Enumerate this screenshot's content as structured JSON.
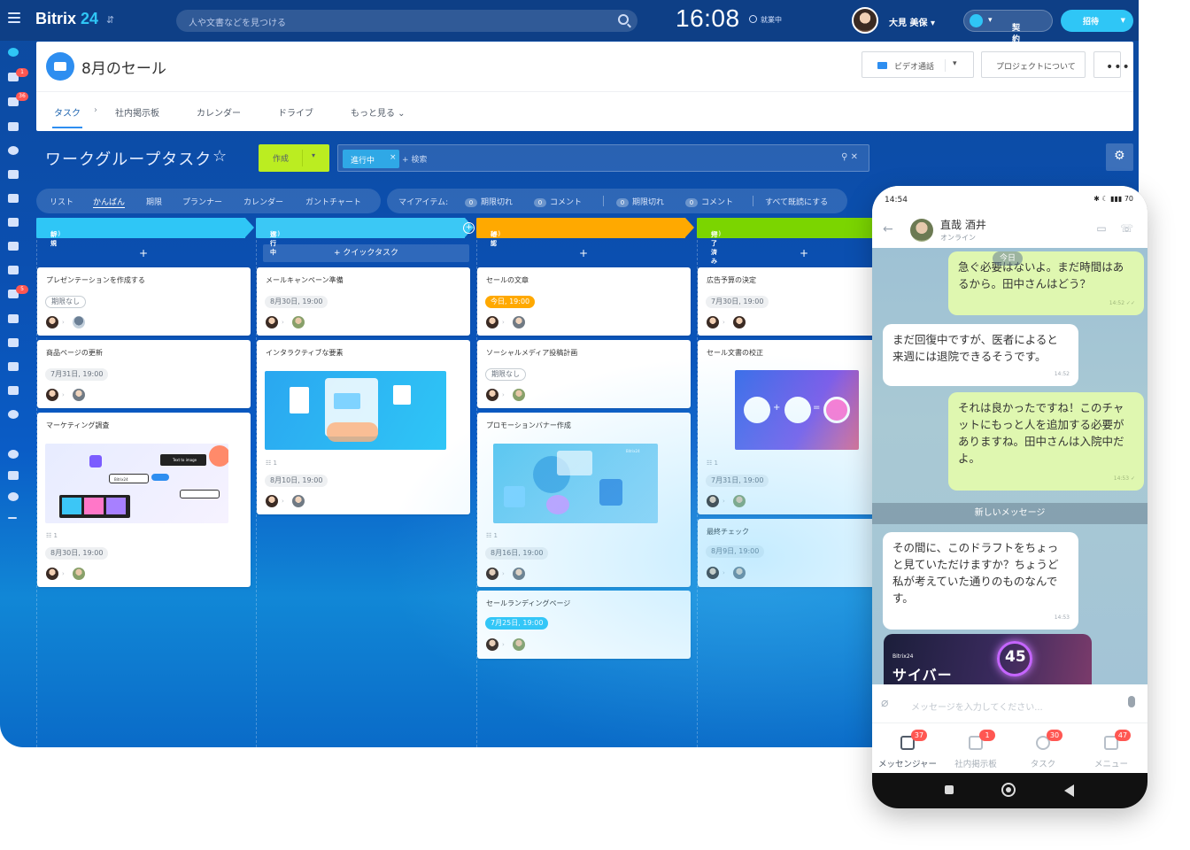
{
  "app": {
    "brand": "Bitrix",
    "brand_num": "24",
    "search_placeholder": "人や文書などを見つける",
    "clock": "16:08",
    "work_status": "就業中",
    "user_name": "大見 美保",
    "plan_label": "契約プラン",
    "invite_label": "招待"
  },
  "rail_badges": [
    "1",
    "36",
    "5"
  ],
  "project": {
    "title": "8月のセール",
    "video_call": "ビデオ通話",
    "about": "プロジェクトについて",
    "tabs": [
      "タスク",
      "社内掲示板",
      "カレンダー",
      "ドライブ",
      "もっと見る"
    ]
  },
  "workgroup": {
    "title": "ワークグループタスク",
    "create": "作成",
    "filter_chip": "進行中",
    "filter_search": "+ 検索"
  },
  "views": [
    "リスト",
    "かんばん",
    "期限",
    "プランナー",
    "カレンダー",
    "ガントチャート"
  ],
  "counters": {
    "my_items": "マイアイテム:",
    "c1": "0",
    "overdue": "期限切れ",
    "c2": "0",
    "comments": "コメント",
    "c3": "0",
    "overdue2": "期限切れ",
    "c4": "0",
    "comments2": "コメント",
    "mark_read": "すべて既読にする"
  },
  "columns": [
    {
      "name": "新規",
      "count": "(3)",
      "color": "#2fc6f6"
    },
    {
      "name": "進行中",
      "count": "(2)",
      "color": "#3bc8f5",
      "quick": "+ クイックタスク"
    },
    {
      "name": "確認",
      "count": "(4)",
      "color": "#ffa900"
    },
    {
      "name": "完了済み",
      "count": "(3)",
      "color": "#7bd500"
    }
  ],
  "cards": {
    "c1": {
      "title": "プレゼンテーションを作成する",
      "date": "期限なし"
    },
    "c2": {
      "title": "商品ページの更新",
      "date": "7月31日, 19:00"
    },
    "c3": {
      "title": "マーケティング調査",
      "count": "1",
      "date": "8月30日, 19:00",
      "img_text1": "Bitrix24",
      "img_text2": "Text to image"
    },
    "c4": {
      "title": "メールキャンペーン準備",
      "date": "8月30日, 19:00"
    },
    "c5": {
      "title": "インタラクティブな要素",
      "count": "1",
      "date": "8月10日, 19:00"
    },
    "c6": {
      "title": "セールの文章",
      "date": "今日, 19:00"
    },
    "c7": {
      "title": "ソーシャルメディア投稿計画",
      "date": "期限なし"
    },
    "c8": {
      "title": "プロモーションバナー作成",
      "count": "1",
      "date": "8月16日, 19:00",
      "img_text": "Bitrix24"
    },
    "c9": {
      "title": "セールランディングページ",
      "date": "7月25日, 19:00"
    },
    "c10": {
      "title": "広告予算の決定",
      "date": "7月30日, 19:00"
    },
    "c11": {
      "title": "セール文書の校正",
      "count": "1",
      "date": "7月31日, 19:00"
    },
    "c12": {
      "title": "最終チェック",
      "date": "8月9日, 19:00"
    }
  },
  "phone": {
    "time": "14:54",
    "status_icons": "✱ ☾ ▮▮▮ 70",
    "contact": "直哉 酒井",
    "online": "オンライン",
    "today": "今日",
    "m1": "急ぐ必要はないよ。まだ時間はあるから。田中さんはどう？",
    "m1_time": "14:52 ✓✓",
    "m2": "まだ回復中ですが、医者によると来週には退院できるそうです。",
    "m2_time": "14:52",
    "m3": "それは良かったですね！このチャットにもっと人を追加する必要がありますね。田中さんは入院中だよ。",
    "m3_time": "14:53 ✓",
    "new_messages": "新しいメッセージ",
    "m4": "その間に、このドラフトをちょっと見ていただけますか？ちょうど私が考えていた通りのものなんです。",
    "m4_time": "14:53",
    "promo_brand": "Bitrix24",
    "promo_title": "サイバー",
    "promo_badge": "45",
    "input_placeholder": "メッセージを入力してください...",
    "tabs": [
      {
        "label": "メッセンジャー",
        "badge": "37"
      },
      {
        "label": "社内掲示板",
        "badge": "1"
      },
      {
        "label": "タスク",
        "badge": "30"
      },
      {
        "label": "メニュー",
        "badge": "47"
      }
    ]
  }
}
